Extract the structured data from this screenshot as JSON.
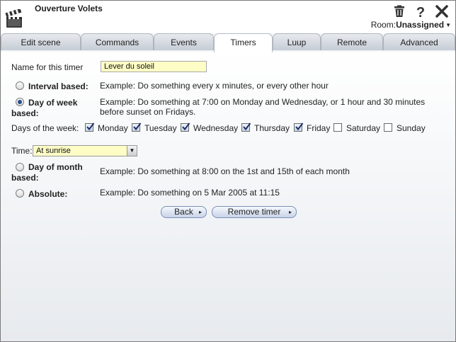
{
  "window": {
    "title": "Ouverture Volets",
    "room_label": "Room:",
    "room_value": "Unassigned"
  },
  "icons": {
    "app": "clapperboard-icon",
    "delete": "trash-icon",
    "help": "question-mark-icon",
    "close": "close-icon"
  },
  "tabs": [
    {
      "label": "Edit scene"
    },
    {
      "label": "Commands"
    },
    {
      "label": "Events"
    },
    {
      "label": "Timers",
      "active": true
    },
    {
      "label": "Luup"
    },
    {
      "label": "Remote"
    },
    {
      "label": "Advanced"
    }
  ],
  "form": {
    "name_label": "Name for this timer",
    "name_value": "Lever du soleil",
    "interval": {
      "label": "Interval based:",
      "checked": false,
      "example": "Example: Do something every x minutes, or every other hour"
    },
    "day_of_week": {
      "label_line1": "Day of week",
      "label_line2": "based:",
      "checked": true,
      "example_line1": "Example: Do something at 7:00 on Monday and Wednesday, or 1 hour and 30 minutes",
      "example_line2": "before sunset on Fridays."
    },
    "days_label": "Days of the week:",
    "days": [
      {
        "label": "Monday",
        "checked": true
      },
      {
        "label": "Tuesday",
        "checked": true
      },
      {
        "label": "Wednesday",
        "checked": true
      },
      {
        "label": "Thursday",
        "checked": true
      },
      {
        "label": "Friday",
        "checked": true
      },
      {
        "label": "Saturday",
        "checked": false
      },
      {
        "label": "Sunday",
        "checked": false
      }
    ],
    "time_label": "Time:",
    "time_value": "At sunrise",
    "day_of_month": {
      "label_line1": "Day of month",
      "label_line2": "based:",
      "checked": false,
      "example": "Example: Do something at 8:00 on the 1st and 15th of each month"
    },
    "absolute": {
      "label": "Absolute:",
      "checked": false,
      "example": "Example: Do something on 5 Mar 2005 at 11:15"
    }
  },
  "buttons": {
    "back": "Back",
    "remove": "Remove timer"
  }
}
